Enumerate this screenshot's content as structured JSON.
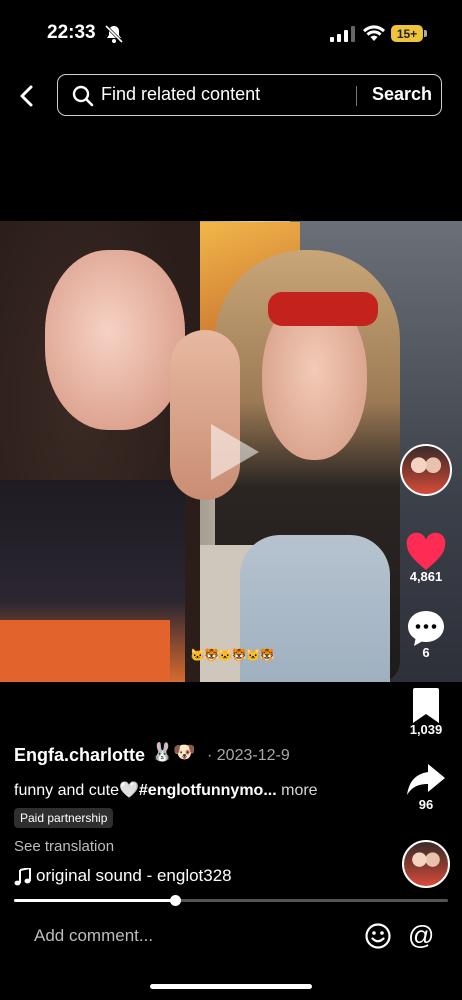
{
  "status_bar": {
    "time": "22:33",
    "battery": "15+"
  },
  "search": {
    "placeholder": "Find related content",
    "button_label": "Search"
  },
  "video": {
    "sticker_text": "🐱🐯🐱🐯🐱🐯"
  },
  "rail": {
    "likes": "4,861",
    "comments": "6",
    "saves": "1,039",
    "shares": "96",
    "like_color": "#fe2c55"
  },
  "post": {
    "username": "Engfa.charlotte",
    "username_emoji": "🐰🐶",
    "date": "· 2023-12-9",
    "caption_text": "funny and cute🤍",
    "caption_hashtag": "#englotfunnymo...",
    "more_label": "more",
    "paid_label": "Paid partnership",
    "translate_label": "See translation",
    "sound": "original sound - englot328"
  },
  "progress": {
    "fraction": 0.37
  },
  "comment_bar": {
    "placeholder": "Add comment..."
  }
}
